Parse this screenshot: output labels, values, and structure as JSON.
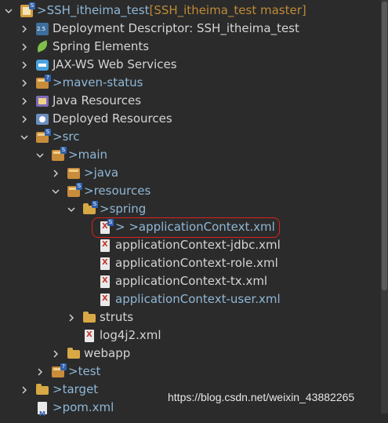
{
  "tree": {
    "project": {
      "prefix": "> ",
      "name": "SSH_itheima_test",
      "branch": " [SSH_itheima_test master]"
    },
    "items": [
      {
        "label": "Deployment Descriptor: SSH_itheima_test"
      },
      {
        "label": "Spring Elements"
      },
      {
        "label": "JAX-WS Web Services"
      },
      {
        "prefix": "> ",
        "label": "maven-status"
      },
      {
        "label": "Java Resources"
      },
      {
        "label": "Deployed Resources"
      },
      {
        "prefix": "> ",
        "label": "src"
      },
      {
        "prefix": "> ",
        "label": "main"
      },
      {
        "prefix": "> ",
        "label": "java"
      },
      {
        "prefix": "> ",
        "label": "resources"
      },
      {
        "prefix": "> ",
        "label": "spring"
      },
      {
        "prefix": "> > ",
        "label": "applicationContext.xml"
      },
      {
        "label": "applicationContext-jdbc.xml"
      },
      {
        "label": "applicationContext-role.xml"
      },
      {
        "label": "applicationContext-tx.xml"
      },
      {
        "label": "applicationContext-user.xml"
      },
      {
        "label": "struts"
      },
      {
        "label": "log4j2.xml"
      },
      {
        "label": "webapp"
      },
      {
        "prefix": "> ",
        "label": "test"
      },
      {
        "prefix": "> ",
        "label": "target"
      },
      {
        "prefix": "> ",
        "label": "pom.xml"
      }
    ]
  },
  "watermark": "https://blog.csdn.net/weixin_43882265",
  "colors": {
    "background": "#2b2b2b",
    "text": "#d4d4d4",
    "decorator": "#8fb7d6",
    "branch": "#c08a37",
    "highlight": "#dd2222"
  }
}
